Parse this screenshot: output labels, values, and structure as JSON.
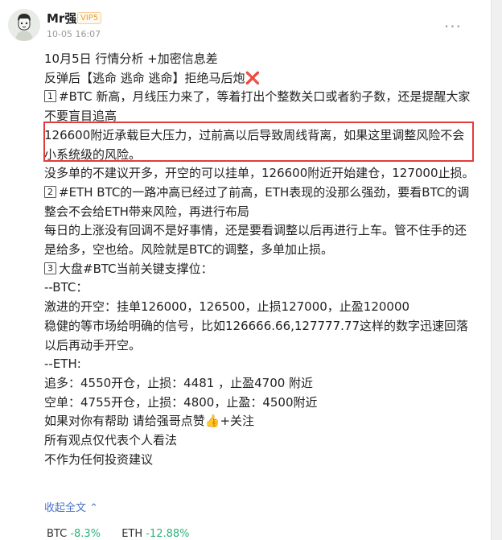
{
  "author": {
    "name": "Mr强",
    "vip_badge": "VIP5",
    "time": "10-05 16:07"
  },
  "more_label": "···",
  "post": {
    "title": "10月5日 行情分析 +加密信息差",
    "subtitle": "反弹后【逃命 逃命 逃命】拒绝马后炮",
    "subtitle_icon": "❌",
    "s1_num": "1",
    "s1_text": "#BTC 新高，月线压力来了，等着打出个整数关口或者豹子数，还是提醒大家不要盲目追高",
    "s1_highlight": "126600附近承载巨大压力，过前高以后导致周线背离，如果这里调整风险不会小系统级的风险。",
    "s1_advice": "没多单的不建议开多，开空的可以挂单，126600附近开始建仓，127000止损。",
    "s2_num": "2",
    "s2_text": "#ETH BTC的一路冲高已经过了前高，ETH表现的没那么强劲，要看BTC的调整会不会给ETH带来风险，再进行布局",
    "s2_text2": "每日的上涨没有回调不是好事情，还是要看调整以后再进行上车。管不住手的还是给多，空也给。风险就是BTC的调整，多单加止损。",
    "s3_num": "3",
    "s3_title": "大盘#BTC当前关键支撑位：",
    "btc_label": "--BTC：",
    "btc_aggressive": "激进的开空：挂单126000，126500，止损127000，止盈120000",
    "btc_steady": "稳健的等市场给明确的信号，比如126666.66,127777.77这样的数字迅速回落以后再动手开空。",
    "eth_label": "--ETH:",
    "eth_long": "追多：4550开仓，止损：4481 ，止盈4700 附近",
    "eth_short": "空单：4755开仓，止损：4800，止盈：4500附近",
    "like_text": "如果对你有帮助 请给强哥点赞",
    "like_icon": "👍",
    "like_follow": "+关注",
    "disclaimer1": "所有观点仅代表个人看法",
    "disclaimer2": "不作为任何投资建议"
  },
  "collapse_label": "收起全文 ⌃",
  "tickers": [
    {
      "symbol": "BTC",
      "change": "-8.3%"
    },
    {
      "symbol": "ETH",
      "change": "-12.88%"
    }
  ],
  "colors": {
    "highlight_border": "#e23b3b",
    "link": "#4a72c4",
    "ticker_change": "#2fb27b",
    "vip": "#e6a23c"
  }
}
